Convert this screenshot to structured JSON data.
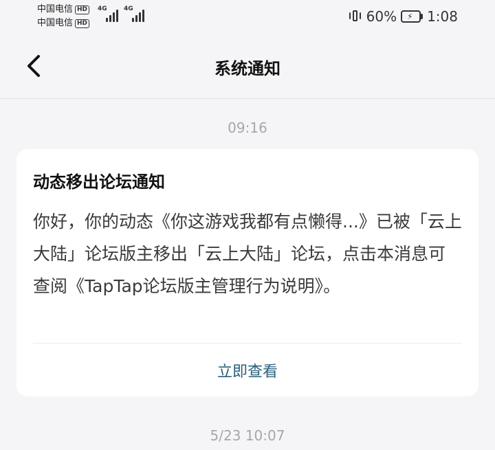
{
  "status_bar": {
    "carrier_1": "中国电信",
    "carrier_2": "中国电信",
    "hd_label": "HD",
    "net_1": "4G",
    "net_2": "4G",
    "battery_percent": "60%",
    "time": "1:08"
  },
  "header": {
    "title": "系统通知"
  },
  "messages": [
    {
      "timestamp": "09:16",
      "title": "动态移出论坛通知",
      "body": "你好，你的动态《你这游戏我都有点懒得...》已被「云上大陆」论坛版主移出「云上大陆」论坛，点击本消息可查阅《TapTap论坛版主管理行为说明》。",
      "action_label": "立即查看"
    },
    {
      "timestamp": "5/23  10:07"
    }
  ],
  "colors": {
    "background": "#f5f5f7",
    "card": "#ffffff",
    "link": "#2a5f7a",
    "timestamp": "#a7a7ab"
  }
}
